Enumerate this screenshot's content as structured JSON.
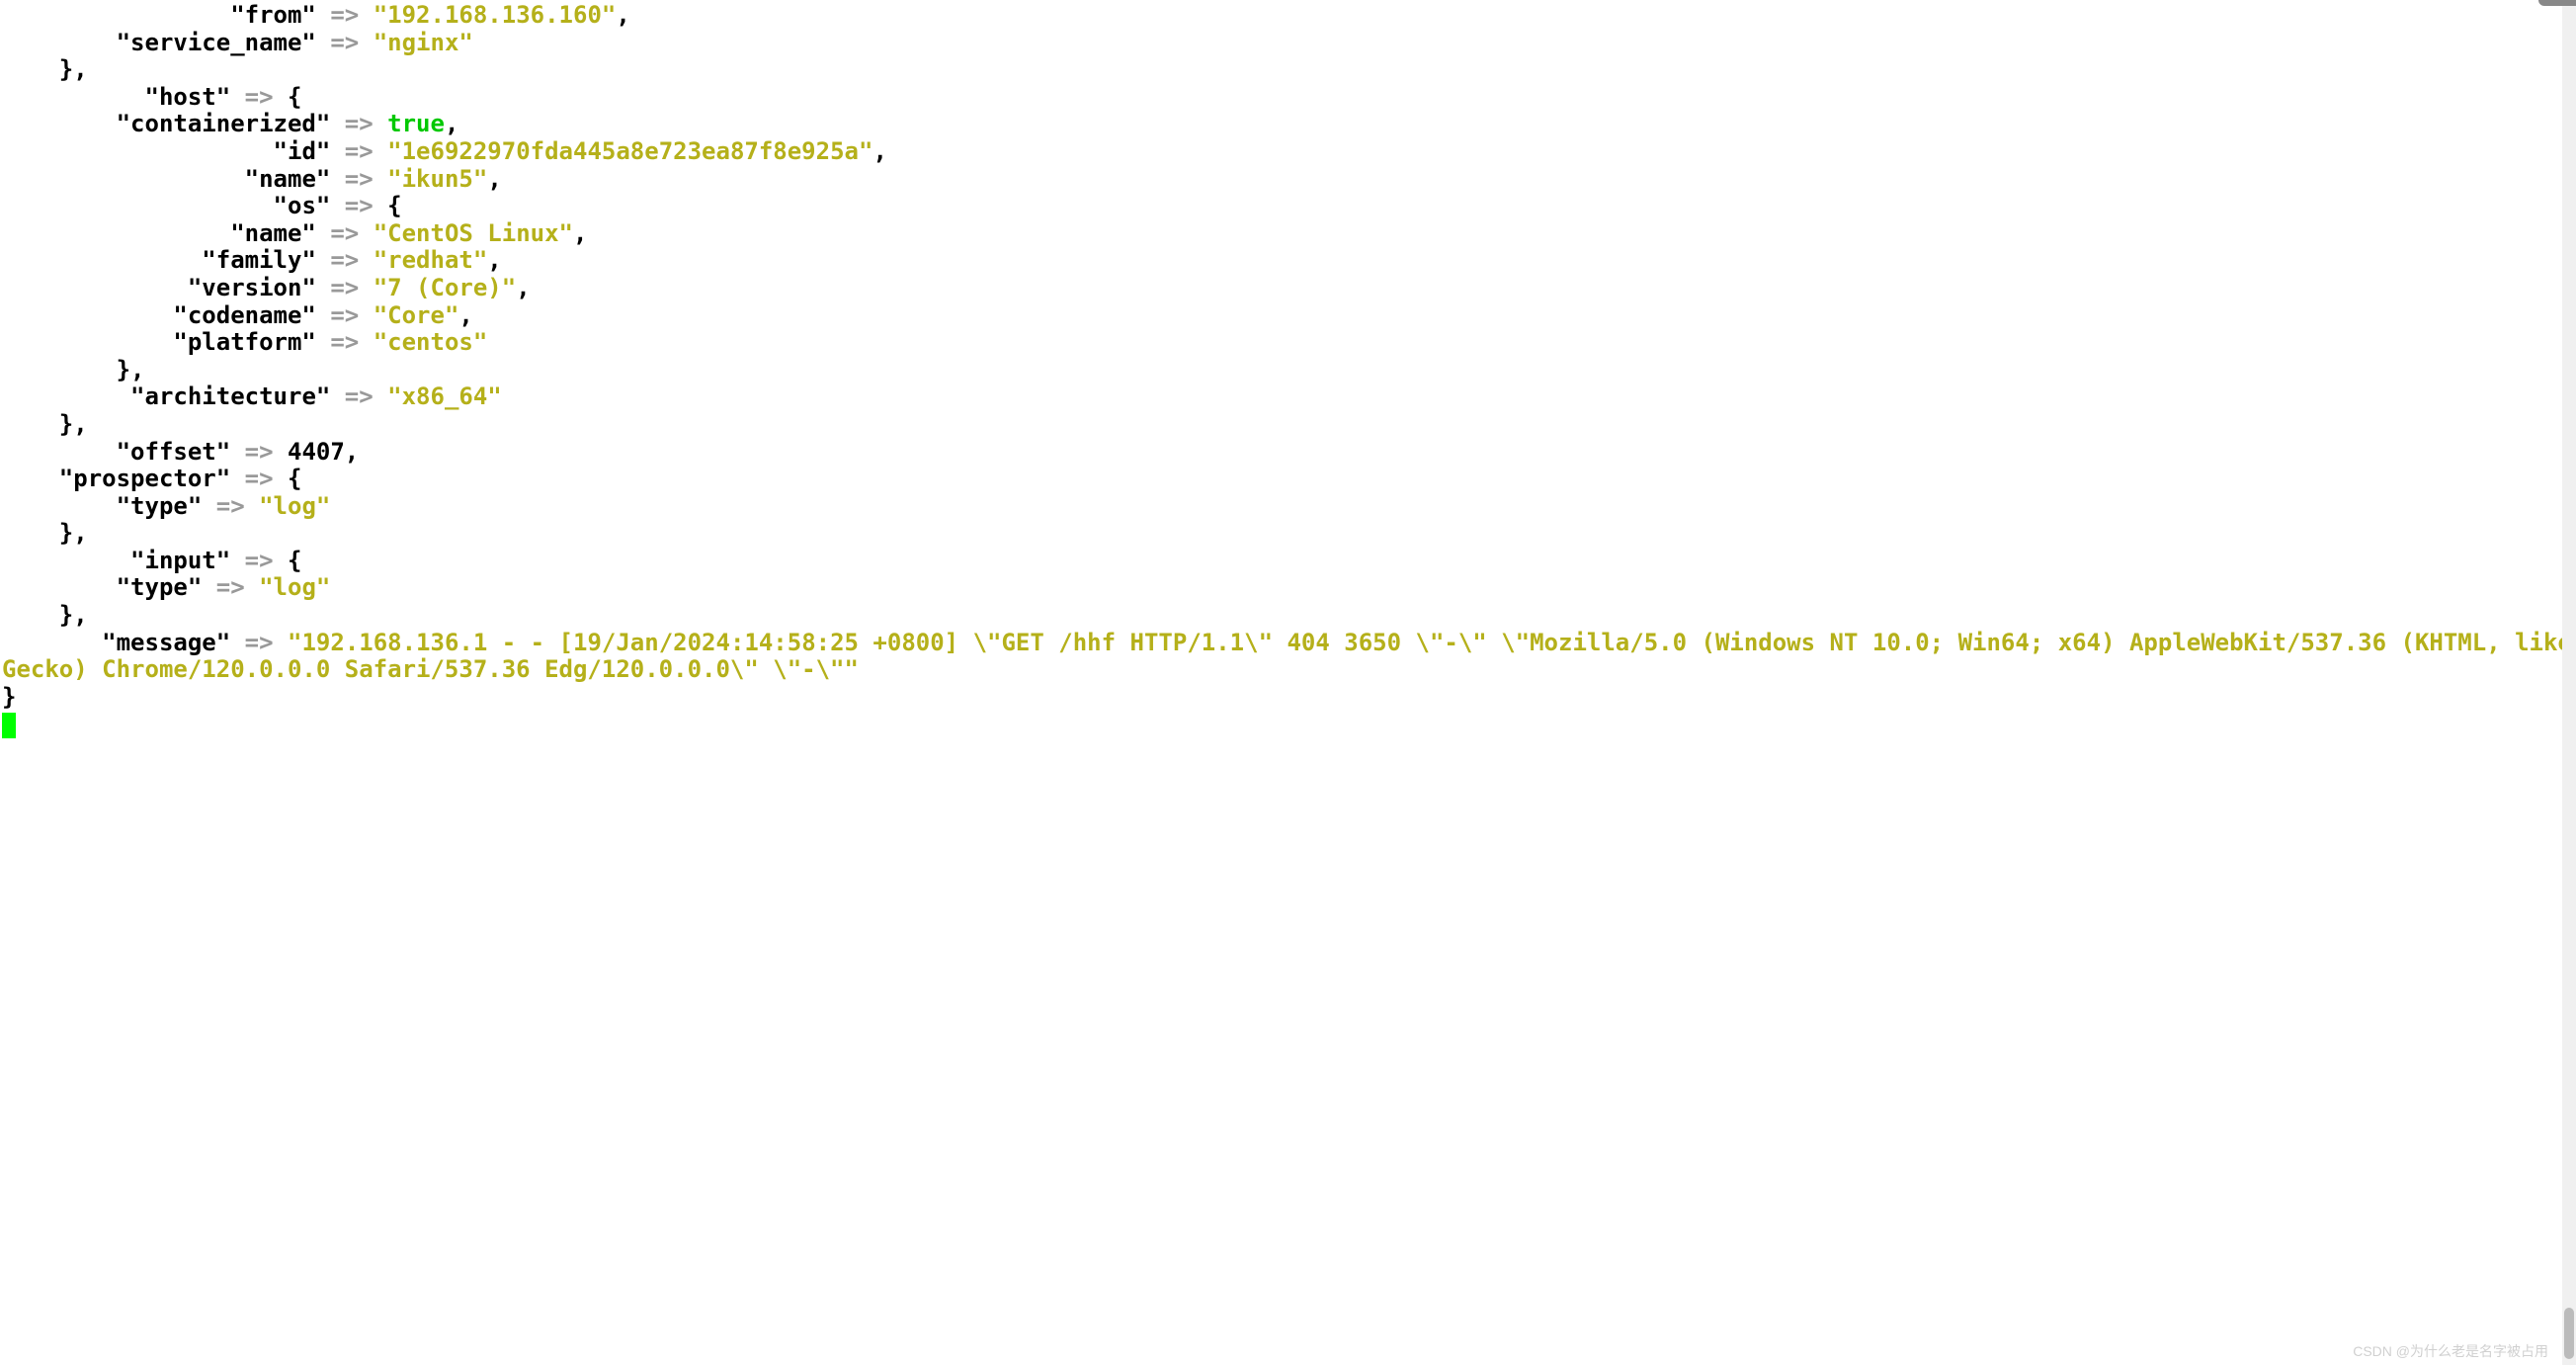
{
  "lines": {
    "from_key": "\"from\"",
    "from_val": "\"192.168.136.160\"",
    "service_name_key": "\"service_name\"",
    "service_name_val": "\"nginx\"",
    "host_key": "\"host\"",
    "containerized_key": "\"containerized\"",
    "containerized_val": "true",
    "id_key": "\"id\"",
    "id_val": "\"1e6922970fda445a8e723ea87f8e925a\"",
    "host_name_key": "\"name\"",
    "host_name_val": "\"ikun5\"",
    "os_key": "\"os\"",
    "os_name_key": "\"name\"",
    "os_name_val": "\"CentOS Linux\"",
    "family_key": "\"family\"",
    "family_val": "\"redhat\"",
    "version_key": "\"version\"",
    "version_val": "\"7 (Core)\"",
    "codename_key": "\"codename\"",
    "codename_val": "\"Core\"",
    "platform_key": "\"platform\"",
    "platform_val": "\"centos\"",
    "architecture_key": "\"architecture\"",
    "architecture_val": "\"x86_64\"",
    "offset_key": "\"offset\"",
    "offset_val": "4407",
    "prospector_key": "\"prospector\"",
    "prospector_type_key": "\"type\"",
    "prospector_type_val": "\"log\"",
    "input_key": "\"input\"",
    "input_type_key": "\"type\"",
    "input_type_val": "\"log\"",
    "message_key": "\"message\"",
    "message_val": "\"192.168.136.1 - - [19/Jan/2024:14:58:25 +0800] \\\"GET /hhf HTTP/1.1\\\" 404 3650 \\\"-\\\" \\\"Mozilla/5.0 (Windows NT 10.0; Win64; x64) AppleWebKit/537.36 (KHTML, like Gecko) Chrome/120.0.0.0 Safari/537.36 Edg/120.0.0.0\\\" \\\"-\\\"\""
  },
  "arrow": "=>",
  "watermark": "CSDN @为什么老是名字被占用"
}
